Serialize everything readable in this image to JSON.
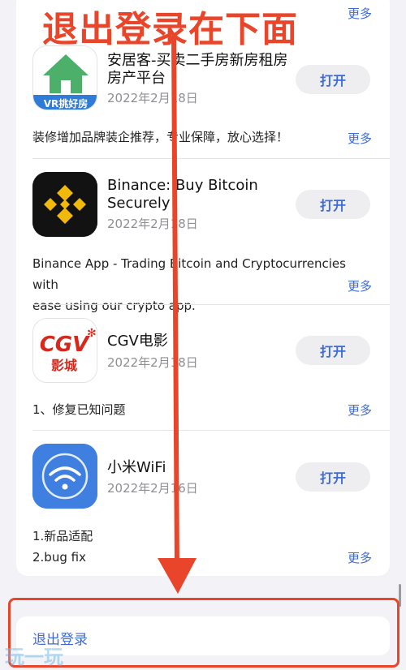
{
  "overlay": {
    "title": "退出登录在下面"
  },
  "top_more": "更多",
  "apps": [
    {
      "icon": "anjuke-house-icon",
      "icon_badge": "VR挑好房",
      "name": "安居客-买卖二手房新房租房房产平台",
      "date": "2022年2月18日",
      "open": "打开",
      "description": [
        "装修增加品牌装企推荐，专业保障，放心选择！"
      ],
      "more": "更多"
    },
    {
      "icon": "binance-logo-icon",
      "name": "Binance: Buy Bitcoin Securely",
      "date": "2022年2月18日",
      "open": "打开",
      "description": [
        "Binance App - Trading Bitcoin and Cryptocurrencies with",
        "ease using our crypto app."
      ],
      "more": "更多"
    },
    {
      "icon": "cgv-logo-icon",
      "icon_text_top": "CGV",
      "icon_text_bottom": "影城",
      "name": "CGV电影",
      "date": "2022年2月18日",
      "open": "打开",
      "description": [
        "1、修复已知问题"
      ],
      "more": "更多"
    },
    {
      "icon": "wifi-icon",
      "name": "小米WiFi",
      "date": "2022年2月16日",
      "open": "打开",
      "description": [
        "1.新品适配",
        "2.bug fix"
      ],
      "more": "更多"
    }
  ],
  "logout": {
    "label": "退出登录"
  },
  "watermark": "玩一玩",
  "colors": {
    "accent": "#3f6bd6",
    "annotation_red": "#e8452a",
    "background": "#f2f2f7"
  }
}
